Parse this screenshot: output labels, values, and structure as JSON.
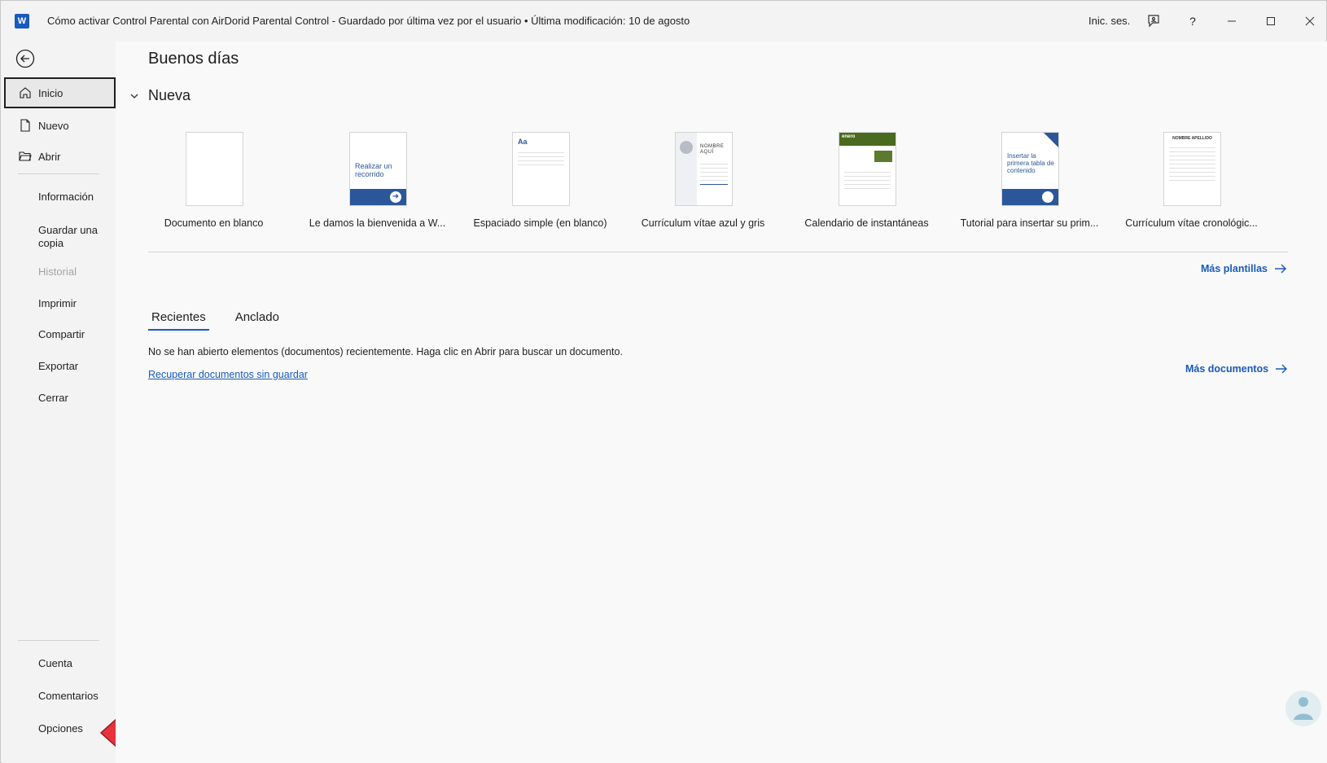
{
  "titlebar": {
    "title": "Cómo activar Control Parental con AirDorid Parental Control  -  Guardado por última vez por el usuario • Última modificación: 10 de agosto",
    "signin": "Inic. ses.",
    "app_icon_letter": "W"
  },
  "sidebar": {
    "items": [
      {
        "label": "Inicio"
      },
      {
        "label": "Nuevo"
      },
      {
        "label": "Abrir"
      },
      {
        "label": "Información"
      },
      {
        "label": "Guardar una copia"
      },
      {
        "label": "Historial"
      },
      {
        "label": "Imprimir"
      },
      {
        "label": "Compartir"
      },
      {
        "label": "Exportar"
      },
      {
        "label": "Cerrar"
      },
      {
        "label": "Cuenta"
      },
      {
        "label": "Comentarios"
      },
      {
        "label": "Opciones"
      }
    ]
  },
  "main": {
    "greeting": "Buenos días",
    "new_section": "Nueva",
    "templates": [
      {
        "label": "Documento en blanco"
      },
      {
        "label": "Le damos la bienvenida a W...",
        "thumb_text": "Realizar un recorrido"
      },
      {
        "label": "Espaciado simple (en blanco)",
        "thumb_text": "Aa"
      },
      {
        "label": "Currículum vítae azul y gris",
        "thumb_text": "NOMBRE AQUÍ"
      },
      {
        "label": "Calendario de instantáneas",
        "thumb_text": "enero"
      },
      {
        "label": "Tutorial para insertar su prim...",
        "thumb_text": "Insertar la primera tabla de contenido"
      },
      {
        "label": "Currículum vítae cronológic...",
        "thumb_text": "NOMBRE APELLIDO"
      }
    ],
    "more_templates": "Más plantillas",
    "tabs": [
      "Recientes",
      "Anclado"
    ],
    "empty_message": "No se han abierto elementos (documentos) recientemente. Haga clic en Abrir para buscar un documento.",
    "recover_link": "Recuperar documentos sin guardar",
    "more_documents": "Más documentos"
  }
}
